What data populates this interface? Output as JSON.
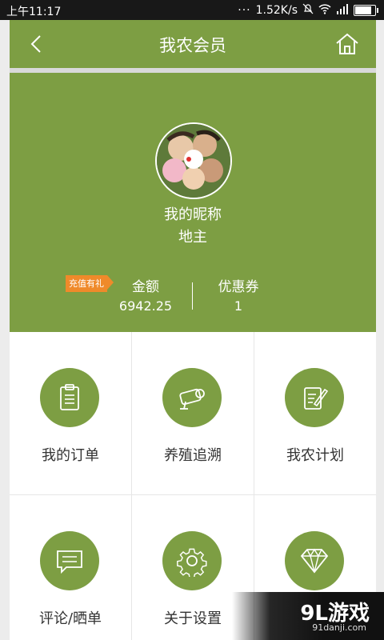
{
  "status_bar": {
    "time": "上午11:17",
    "dots": "···",
    "speed": "1.52K/s",
    "icons": [
      "mute-icon",
      "wifi-icon",
      "signal-icon",
      "battery-icon"
    ]
  },
  "header": {
    "title": "我农会员",
    "back_icon": "back-arrow-icon",
    "home_icon": "home-icon"
  },
  "profile": {
    "nickname": "我的昵称",
    "level": "地主",
    "recharge_tag": "充值有礼",
    "amount_label": "金额",
    "amount_value": "6942.25",
    "coupon_label": "优惠券",
    "coupon_value": "1"
  },
  "menu": [
    {
      "label": "我的订单",
      "icon": "order-clipboard-icon"
    },
    {
      "label": "养殖追溯",
      "icon": "camera-trace-icon"
    },
    {
      "label": "我农计划",
      "icon": "plan-edit-icon"
    },
    {
      "label": "评论/晒单",
      "icon": "comment-icon"
    },
    {
      "label": "关于设置",
      "icon": "settings-gear-icon"
    },
    {
      "label": "",
      "icon": "diamond-icon"
    }
  ],
  "watermark": {
    "main": "9L游戏",
    "sub": "91danji.com"
  },
  "colors": {
    "theme_green": "#7d9e43",
    "tag_orange": "#ef8a2a",
    "status_bar": "#181818"
  }
}
